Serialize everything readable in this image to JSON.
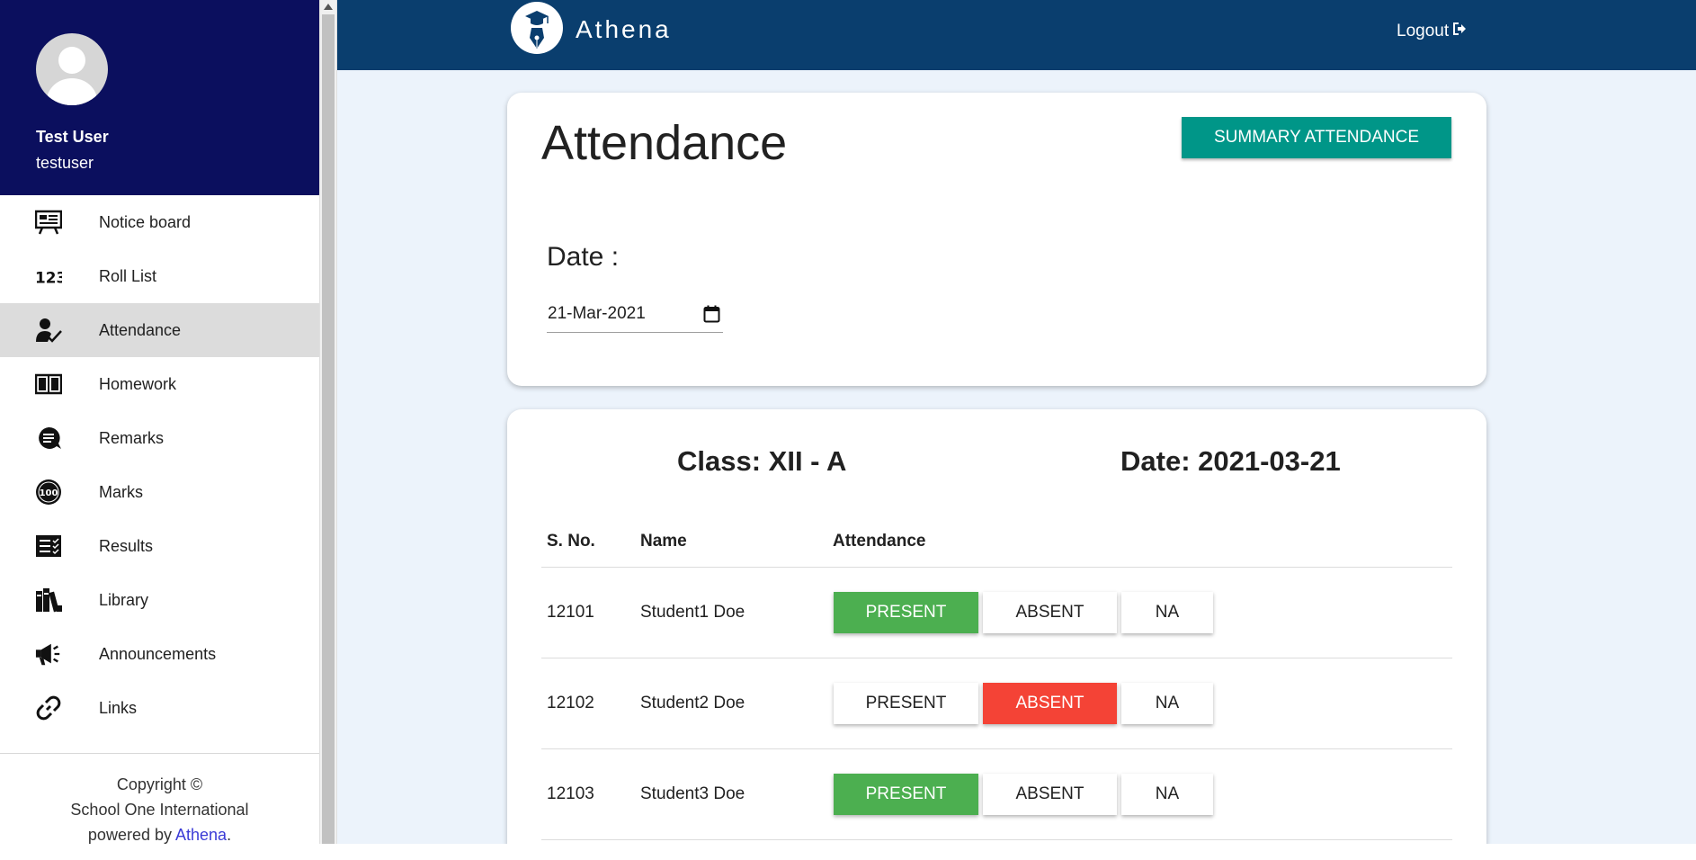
{
  "profile": {
    "name": "Test User",
    "username": "testuser"
  },
  "menu": [
    {
      "label": "Notice board",
      "icon": "notice-board-icon"
    },
    {
      "label": "Roll List",
      "icon": "numbers-icon"
    },
    {
      "label": "Attendance",
      "icon": "person-check-icon",
      "active": true
    },
    {
      "label": "Homework",
      "icon": "book-icon"
    },
    {
      "label": "Remarks",
      "icon": "chat-bubble-icon"
    },
    {
      "label": "Marks",
      "icon": "hundred-icon"
    },
    {
      "label": "Results",
      "icon": "list-check-icon"
    },
    {
      "label": "Library",
      "icon": "books-icon"
    },
    {
      "label": "Announcements",
      "icon": "megaphone-icon"
    },
    {
      "label": "Links",
      "icon": "link-icon"
    }
  ],
  "footer": {
    "line1": "Copyright ©",
    "line2": "School One International",
    "powered_prefix": "powered by ",
    "powered_link": "Athena",
    "powered_suffix": "."
  },
  "topbar": {
    "brand": "Athena",
    "logout_label": "Logout"
  },
  "attendance_card": {
    "title": "Attendance",
    "summary_button": "SUMMARY ATTENDANCE",
    "date_label": "Date :",
    "date_value": "21-Mar-2021"
  },
  "class_card": {
    "class_title": "Class: XII - A",
    "date_title": "Date: 2021-03-21",
    "columns": [
      "S. No.",
      "Name",
      "Attendance"
    ],
    "buttons": {
      "present": "PRESENT",
      "absent": "ABSENT",
      "na": "NA"
    },
    "rows": [
      {
        "sno": "12101",
        "name": "Student1 Doe",
        "status": "present"
      },
      {
        "sno": "12102",
        "name": "Student2 Doe",
        "status": "absent"
      },
      {
        "sno": "12103",
        "name": "Student3 Doe",
        "status": "present"
      }
    ]
  },
  "colors": {
    "sidebar_header": "#0b0f5e",
    "topbar": "#0a3e6e",
    "summary": "#009688",
    "present": "#4caf50",
    "absent": "#f44336",
    "main_bg": "#ecf3fb"
  }
}
